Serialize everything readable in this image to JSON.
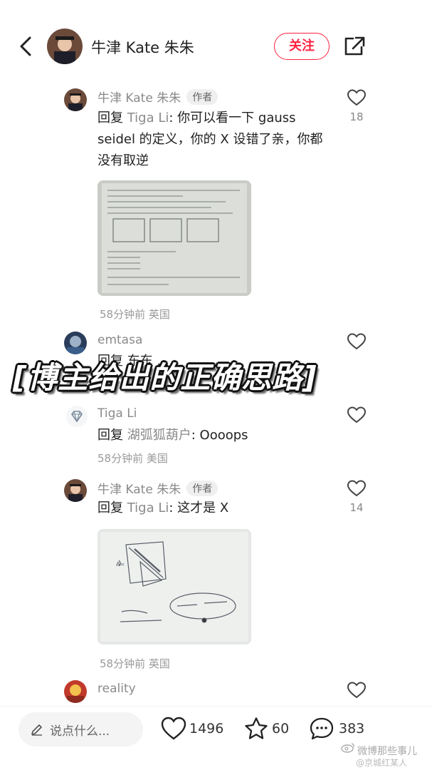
{
  "header": {
    "user_name": "牛津 Kate 朱朱",
    "follow_label": "关注"
  },
  "comments": [
    {
      "user": "牛津 Kate 朱朱",
      "badge": "作者",
      "reply_prefix": "回复",
      "reply_to": "Tiga Li",
      "text_line1": ": 你可以看一下 gauss",
      "text_line2": "seidel 的定义，你的 X 设错了亲，你都",
      "text_line3": "没有取逆",
      "meta": "58分钟前 英国",
      "likes": "18"
    },
    {
      "user": "emtasa",
      "text": "回复 东东 ...",
      "likes": ""
    },
    {
      "user": "Tiga Li",
      "reply_prefix": "回复",
      "reply_to": "湖弧狐葫户",
      "text": ": Oooops",
      "meta": "58分钟前 美国",
      "likes": ""
    },
    {
      "user": "牛津 Kate 朱朱",
      "badge": "作者",
      "reply_prefix": "回复",
      "reply_to": "Tiga Li",
      "text": ": 这才是 X",
      "meta": "58分钟前 英国",
      "likes": "14"
    },
    {
      "user": "reality",
      "likes": ""
    }
  ],
  "overlay_caption": "[博主给出的正确思路]",
  "bottom_bar": {
    "input_placeholder": "说点什么...",
    "likes": "1496",
    "favorites": "60",
    "comments": "383"
  },
  "watermark": {
    "line1": "微博那些事儿",
    "line2": "@京城红某人"
  },
  "colors": {
    "accent": "#ff2442",
    "muted_text": "#8a8a8a",
    "primary_text": "#222222"
  },
  "icons": [
    "back-arrow-icon",
    "share-icon",
    "heart-icon",
    "star-icon",
    "comment-bubble-icon",
    "pencil-icon",
    "diamond-icon",
    "weibo-icon"
  ]
}
